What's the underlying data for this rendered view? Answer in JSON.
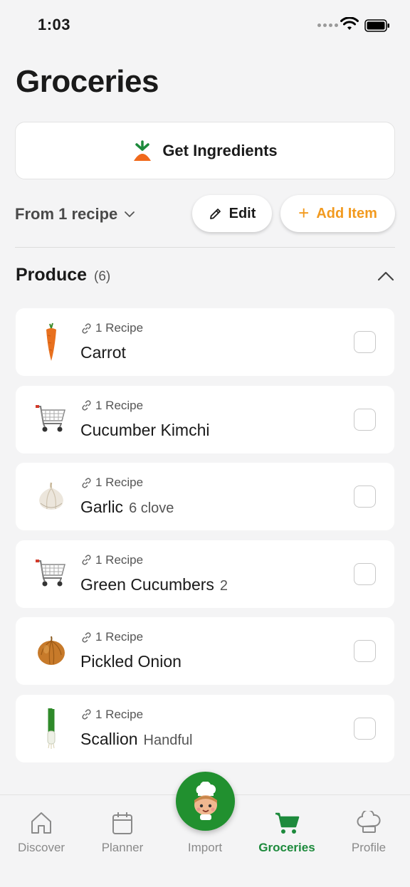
{
  "status_bar": {
    "time": "1:03"
  },
  "title": "Groceries",
  "get_ingredients_label": "Get Ingredients",
  "toolbar": {
    "from_recipe_label": "From 1 recipe",
    "edit_label": "Edit",
    "add_item_label": "Add Item"
  },
  "section": {
    "title": "Produce",
    "count": "(6)"
  },
  "items": [
    {
      "meta": "1 Recipe",
      "name": "Carrot",
      "qty": "",
      "image": "carrot-icon"
    },
    {
      "meta": "1 Recipe",
      "name": "Cucumber Kimchi",
      "qty": "",
      "image": "shopping-cart-icon"
    },
    {
      "meta": "1 Recipe",
      "name": "Garlic",
      "qty": "6 clove",
      "image": "garlic-icon"
    },
    {
      "meta": "1 Recipe",
      "name": "Green Cucumbers",
      "qty": "2",
      "image": "shopping-cart-icon"
    },
    {
      "meta": "1 Recipe",
      "name": "Pickled Onion",
      "qty": "",
      "image": "onion-icon"
    },
    {
      "meta": "1 Recipe",
      "name": "Scallion",
      "qty": "Handful",
      "image": "scallion-icon"
    }
  ],
  "tabs": [
    {
      "label": "Discover",
      "icon": "home-icon"
    },
    {
      "label": "Planner",
      "icon": "calendar-icon"
    },
    {
      "label": "Import",
      "icon": "chef-mascot-icon"
    },
    {
      "label": "Groceries",
      "icon": "cart-icon",
      "active": true
    },
    {
      "label": "Profile",
      "icon": "chef-hat-icon"
    }
  ],
  "colors": {
    "accent_orange": "#f29a1f",
    "accent_green": "#1d8a3c",
    "fab_green": "#21902f"
  }
}
